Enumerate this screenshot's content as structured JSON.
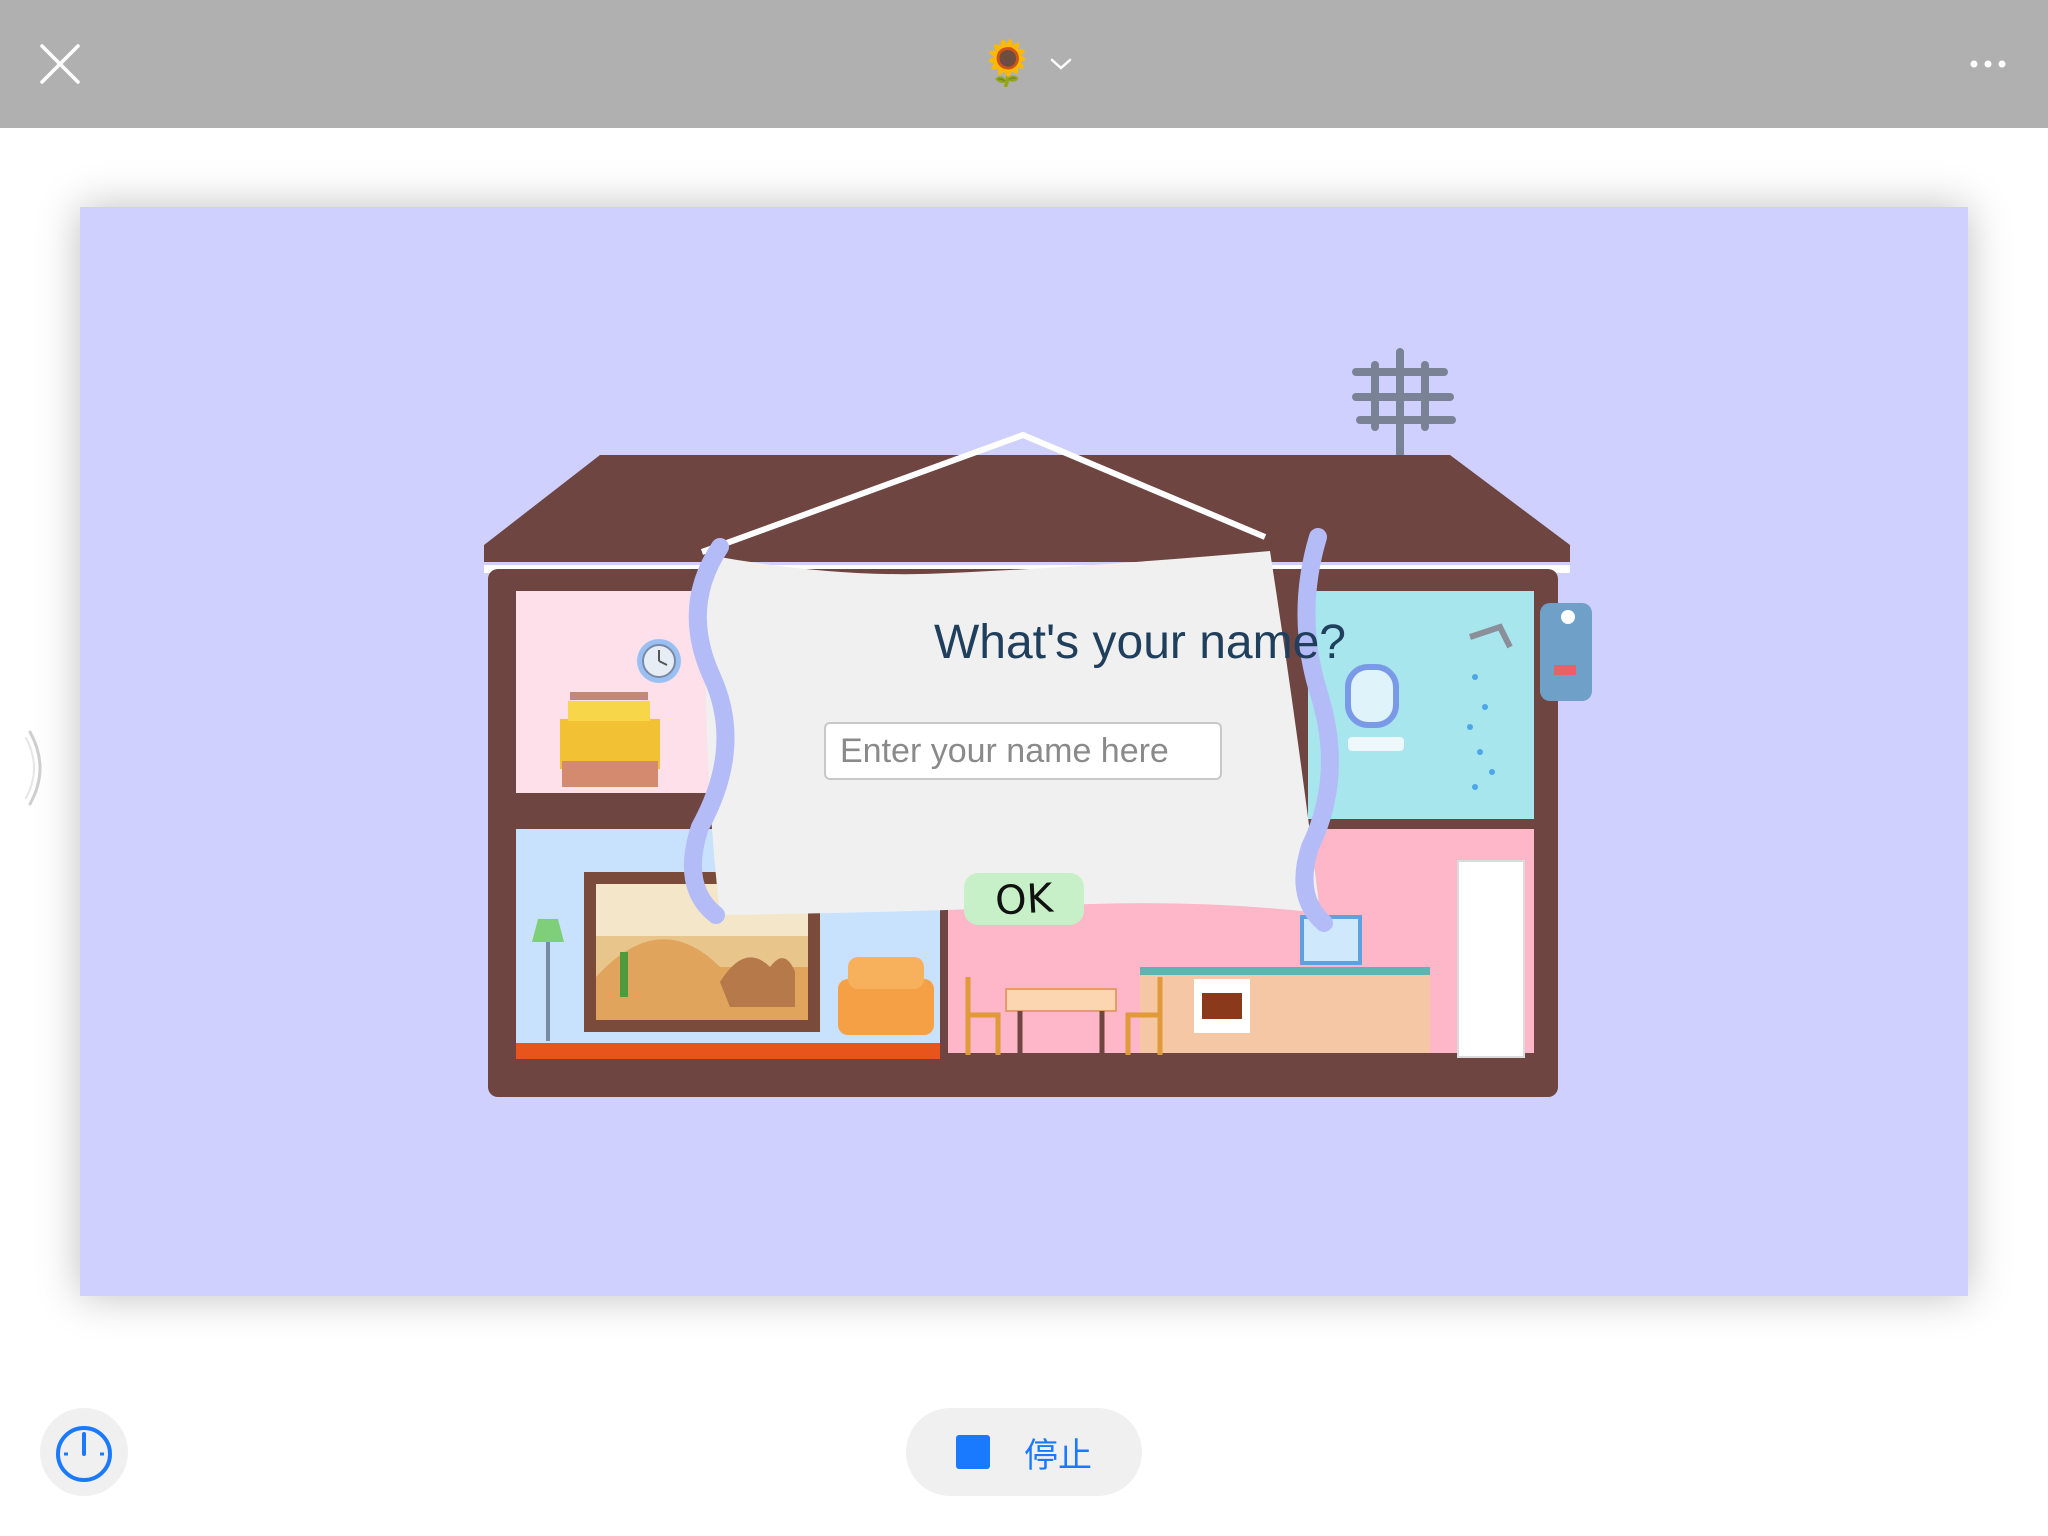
{
  "header": {
    "close_icon": "close-icon",
    "title_emoji": "🌻",
    "title_dropdown_icon": "chevron-down-icon",
    "more_icon": "more-horizontal-icon"
  },
  "sidebar_handle_icon": "chevron-right-icon",
  "dialog": {
    "title": "What's your name?",
    "input_placeholder": "Enter your name here",
    "input_value": "",
    "ok_label": "OK"
  },
  "bottom": {
    "speed_icon": "speedometer-icon",
    "stop_label": "停止",
    "stop_icon": "stop-square-icon"
  },
  "colors": {
    "topbar": "#b0b0b0",
    "stage": "#d0d0fe",
    "accent": "#1a7aff",
    "roof": "#6e4541",
    "ok_button": "#c8f0c8",
    "dialog_title": "#1f3f5c"
  }
}
